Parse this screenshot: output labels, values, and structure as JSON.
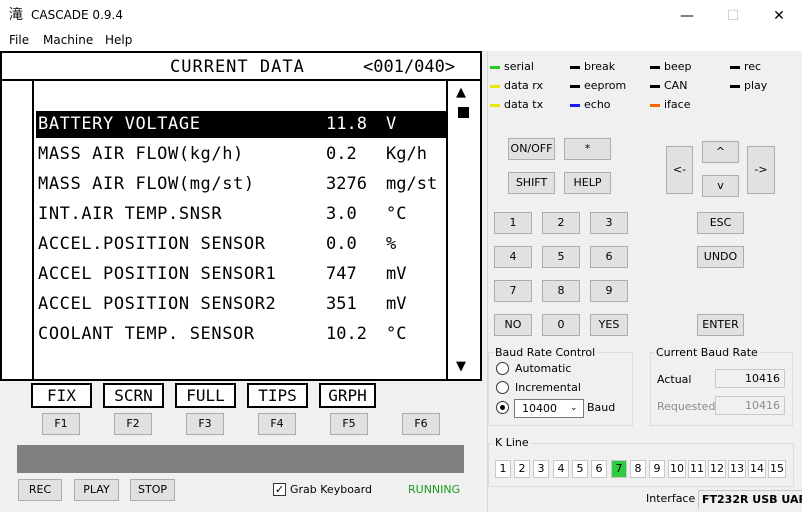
{
  "window": {
    "icon": "滝",
    "title": "CASCADE 0.9.4",
    "minimize": "—",
    "maximize": "☐",
    "close": "✕"
  },
  "menu": [
    "File",
    "Machine",
    "Help"
  ],
  "lcd": {
    "header": "CURRENT DATA",
    "page": "<001/040>",
    "rows": [
      {
        "label": "BATTERY VOLTAGE",
        "value": "11.8",
        "unit": "V",
        "selected": true
      },
      {
        "label": "MASS AIR FLOW(kg/h)",
        "value": "0.2",
        "unit": "Kg/h"
      },
      {
        "label": "MASS AIR FLOW(mg/st)",
        "value": "3276",
        "unit": "mg/st"
      },
      {
        "label": "INT.AIR TEMP.SNSR",
        "value": "3.0",
        "unit": "°C"
      },
      {
        "label": "ACCEL.POSITION SENSOR",
        "value": "0.0",
        "unit": "%"
      },
      {
        "label": "ACCEL POSITION SENSOR1",
        "value": "747",
        "unit": "mV"
      },
      {
        "label": "ACCEL POSITION SENSOR2",
        "value": "351",
        "unit": "mV"
      },
      {
        "label": "COOLANT TEMP. SENSOR",
        "value": "10.2",
        "unit": "°C"
      }
    ],
    "scroll_up": "▲",
    "scroll_down": "▼"
  },
  "softkeys": {
    "labels": [
      "FIX",
      "SCRN",
      "FULL",
      "TIPS",
      "GRPH"
    ],
    "fkeys": [
      "F1",
      "F2",
      "F3",
      "F4",
      "F5",
      "F6"
    ]
  },
  "controls": {
    "rec": "REC",
    "play": "PLAY",
    "stop": "STOP",
    "grab_keyboard": "Grab Keyboard",
    "grab_checked": "✓",
    "status": "RUNNING"
  },
  "legend": [
    {
      "name": "serial",
      "color": "#22cc22"
    },
    {
      "name": "break",
      "color": "#000000"
    },
    {
      "name": "beep",
      "color": "#000000"
    },
    {
      "name": "rec",
      "color": "#000000"
    },
    {
      "name": "data rx",
      "color": "#e8e800"
    },
    {
      "name": "eeprom",
      "color": "#000000"
    },
    {
      "name": "CAN",
      "color": "#000000"
    },
    {
      "name": "play",
      "color": "#000000"
    },
    {
      "name": "data tx",
      "color": "#e8e800"
    },
    {
      "name": "echo",
      "color": "#1a1aff"
    },
    {
      "name": "iface",
      "color": "#ff6600"
    }
  ],
  "keypad": {
    "on_off": "ON/OFF",
    "star": "*",
    "shift": "SHIFT",
    "help": "HELP",
    "left": "<-",
    "up": "^",
    "down": "v",
    "right": "->",
    "digits": [
      "1",
      "2",
      "3",
      "4",
      "5",
      "6",
      "7",
      "8",
      "9"
    ],
    "no": "NO",
    "zero": "0",
    "yes": "YES",
    "esc": "ESC",
    "undo": "UNDO",
    "enter": "ENTER"
  },
  "baud_control": {
    "title": "Baud Rate Control",
    "automatic": "Automatic",
    "incremental": "Incremental",
    "selected_baud": "10400",
    "baud_unit": "Baud"
  },
  "current_baud": {
    "title": "Current Baud Rate",
    "actual_label": "Actual",
    "actual_value": "10416",
    "requested_label": "Requested",
    "requested_value": "10416"
  },
  "k_line": {
    "title": "K Line",
    "lines": [
      "1",
      "2",
      "3",
      "4",
      "5",
      "6",
      "7",
      "8",
      "9",
      "10",
      "11",
      "12",
      "13",
      "14",
      "15"
    ],
    "active": "7"
  },
  "interface": {
    "label": "Interface",
    "value": "FT232R USB UAR"
  }
}
